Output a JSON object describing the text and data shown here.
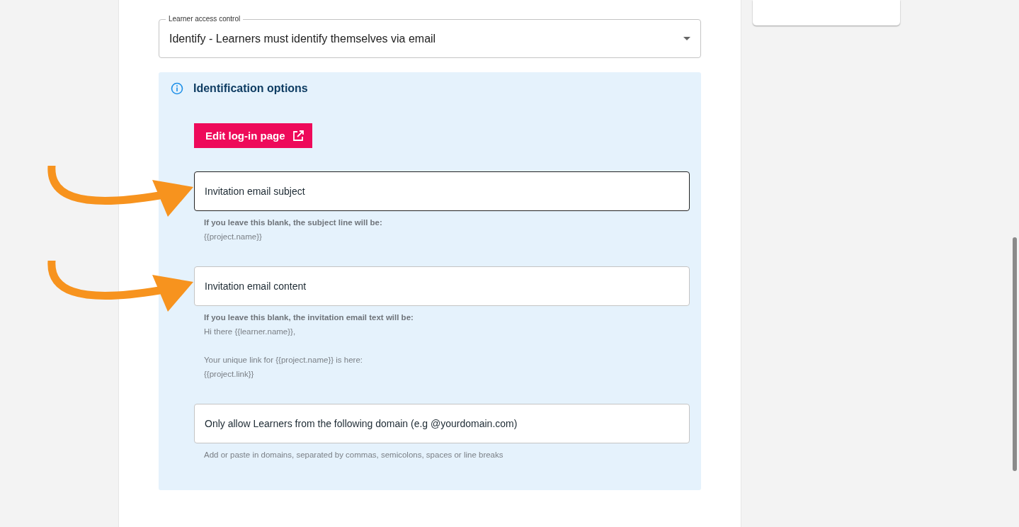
{
  "access_control": {
    "label": "Learner access control",
    "value": "Identify - Learners must identify themselves via email"
  },
  "identification_panel": {
    "title": "Identification options",
    "button": "Edit log-in page",
    "fields": [
      {
        "placeholder": "Invitation email subject",
        "focused": true,
        "annotated": true,
        "help_title": "If you leave this blank, the subject line will be:",
        "help_paragraphs": [
          [
            "{{project.name}}"
          ]
        ]
      },
      {
        "placeholder": "Invitation email content",
        "focused": false,
        "annotated": true,
        "help_title": "If you leave this blank, the invitation email text will be:",
        "help_paragraphs": [
          [
            "Hi there {{learner.name}},"
          ],
          [
            "Your unique link for {{project.name}} is here:",
            "{{project.link}}"
          ]
        ]
      },
      {
        "placeholder": "Only allow Learners from the following domain (e.g @yourdomain.com)",
        "focused": false,
        "annotated": false,
        "help_paragraphs": [
          [
            "Add or paste in domains, separated by commas, semicolons, spaces or line breaks"
          ]
        ]
      }
    ]
  }
}
